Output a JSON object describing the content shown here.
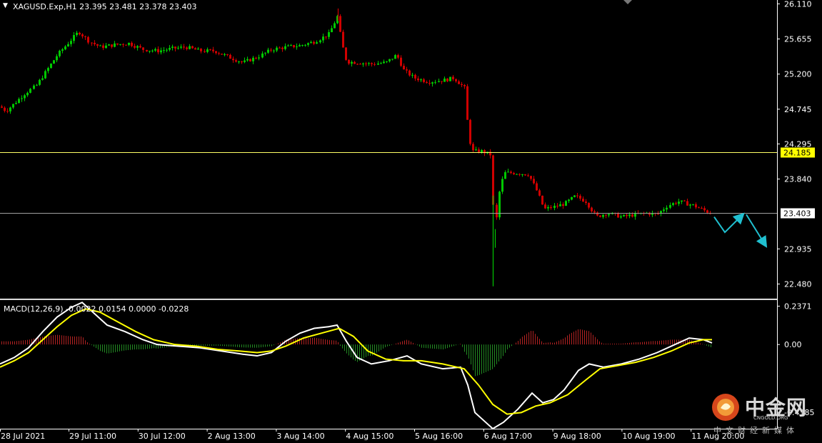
{
  "header": {
    "symbol_line": "XAGUSD.Exp,H1  23.395 23.481 23.378 23.403",
    "macd_line": "MACD(12,26,9) -0.0022 0.0154 0.0000 -0.0228"
  },
  "colors": {
    "background": "#000000",
    "bull": "#00c800",
    "bear": "#d00000",
    "macd_main": "#ffffff",
    "macd_signal": "#ffff00",
    "hist_pos": "#b22222",
    "hist_neg": "#228b22",
    "hline_yellow": "#ffff66",
    "hline_gray": "#a0a0a0",
    "arrow": "#20c0d0",
    "axis": "#ffffff"
  },
  "chart_data": [
    {
      "type": "candlestick",
      "symbol": "XAGUSD.Exp",
      "timeframe": "H1",
      "ohlc_last": {
        "open": 23.395,
        "high": 23.481,
        "low": 23.378,
        "close": 23.403
      },
      "y_ticks": [
        "26.110",
        "25.655",
        "25.200",
        "24.745",
        "24.295",
        "23.840",
        "22.935",
        "22.480"
      ],
      "ylim": [
        22.29,
        26.16
      ],
      "x_ticks": [
        "28 Jul 2021",
        "29 Jul 11:00",
        "30 Jul 12:00",
        "2 Aug 13:00",
        "3 Aug 14:00",
        "4 Aug 15:00",
        "5 Aug 16:00",
        "6 Aug 17:00",
        "9 Aug 18:00",
        "10 Aug 19:00",
        "11 Aug 20:00"
      ],
      "price_path": [
        [
          0,
          24.78
        ],
        [
          8,
          24.72
        ],
        [
          20,
          24.82
        ],
        [
          35,
          24.95
        ],
        [
          50,
          25.05
        ],
        [
          65,
          25.25
        ],
        [
          80,
          25.45
        ],
        [
          95,
          25.6
        ],
        [
          110,
          25.75
        ],
        [
          125,
          25.62
        ],
        [
          140,
          25.55
        ],
        [
          160,
          25.58
        ],
        [
          180,
          25.6
        ],
        [
          200,
          25.52
        ],
        [
          220,
          25.5
        ],
        [
          240,
          25.53
        ],
        [
          260,
          25.55
        ],
        [
          280,
          25.5
        ],
        [
          300,
          25.5
        ],
        [
          320,
          25.42
        ],
        [
          340,
          25.35
        ],
        [
          360,
          25.42
        ],
        [
          380,
          25.52
        ],
        [
          400,
          25.55
        ],
        [
          420,
          25.57
        ],
        [
          440,
          25.62
        ],
        [
          460,
          25.72
        ],
        [
          472,
          25.95
        ],
        [
          478,
          25.6
        ],
        [
          485,
          25.36
        ],
        [
          500,
          25.35
        ],
        [
          520,
          25.33
        ],
        [
          540,
          25.35
        ],
        [
          555,
          25.45
        ],
        [
          565,
          25.25
        ],
        [
          580,
          25.15
        ],
        [
          600,
          25.1
        ],
        [
          620,
          25.12
        ],
        [
          635,
          25.15
        ],
        [
          650,
          25.02
        ],
        [
          655,
          24.5
        ],
        [
          660,
          24.2
        ],
        [
          675,
          24.2
        ],
        [
          688,
          24.15
        ],
        [
          692,
          23.1
        ],
        [
          698,
          23.65
        ],
        [
          705,
          23.92
        ],
        [
          720,
          23.92
        ],
        [
          740,
          23.9
        ],
        [
          752,
          23.68
        ],
        [
          762,
          23.45
        ],
        [
          775,
          23.48
        ],
        [
          790,
          23.52
        ],
        [
          805,
          23.62
        ],
        [
          820,
          23.55
        ],
        [
          835,
          23.35
        ],
        [
          850,
          23.4
        ],
        [
          870,
          23.35
        ],
        [
          890,
          23.38
        ],
        [
          905,
          23.4
        ],
        [
          920,
          23.38
        ],
        [
          935,
          23.5
        ],
        [
          950,
          23.55
        ],
        [
          970,
          23.5
        ],
        [
          994,
          23.4
        ]
      ],
      "big_wicks": [
        {
          "x": 690,
          "low": 22.45
        },
        {
          "x": 473,
          "high": 26.05
        },
        {
          "x": 693,
          "low": 22.95
        }
      ],
      "horizontal_levels": [
        {
          "price": 24.185,
          "label": "24.185",
          "color": "#ffff66"
        },
        {
          "price": 23.403,
          "label": "23.403",
          "color": "#a0a0a0"
        }
      ],
      "forecast_arrows": [
        [
          [
            1000,
            23.35
          ],
          [
            1015,
            23.15
          ],
          [
            1040,
            23.38
          ]
        ],
        [
          [
            1045,
            23.38
          ],
          [
            1072,
            22.98
          ]
        ]
      ]
    },
    {
      "type": "macd",
      "params": "12,26,9",
      "y_ticks": [
        "0.2371",
        "0.00",
        "-0.4185"
      ],
      "ylim": [
        -0.52,
        0.27
      ],
      "main": [
        [
          0,
          -0.12
        ],
        [
          20,
          -0.08
        ],
        [
          40,
          -0.02
        ],
        [
          60,
          0.08
        ],
        [
          80,
          0.17
        ],
        [
          100,
          0.23
        ],
        [
          115,
          0.26
        ],
        [
          130,
          0.2
        ],
        [
          150,
          0.12
        ],
        [
          175,
          0.08
        ],
        [
          200,
          0.03
        ],
        [
          220,
          0.0
        ],
        [
          250,
          -0.01
        ],
        [
          280,
          -0.02
        ],
        [
          310,
          -0.04
        ],
        [
          340,
          -0.06
        ],
        [
          360,
          -0.07
        ],
        [
          380,
          -0.05
        ],
        [
          400,
          0.02
        ],
        [
          420,
          0.07
        ],
        [
          440,
          0.1
        ],
        [
          460,
          0.11
        ],
        [
          472,
          0.12
        ],
        [
          485,
          0.02
        ],
        [
          500,
          -0.08
        ],
        [
          520,
          -0.12
        ],
        [
          545,
          -0.1
        ],
        [
          570,
          -0.07
        ],
        [
          590,
          -0.12
        ],
        [
          620,
          -0.15
        ],
        [
          645,
          -0.14
        ],
        [
          655,
          -0.25
        ],
        [
          665,
          -0.42
        ],
        [
          680,
          -0.48
        ],
        [
          690,
          -0.52
        ],
        [
          705,
          -0.48
        ],
        [
          725,
          -0.4
        ],
        [
          745,
          -0.3
        ],
        [
          760,
          -0.36
        ],
        [
          775,
          -0.34
        ],
        [
          790,
          -0.28
        ],
        [
          810,
          -0.16
        ],
        [
          825,
          -0.12
        ],
        [
          845,
          -0.14
        ],
        [
          870,
          -0.12
        ],
        [
          895,
          -0.09
        ],
        [
          920,
          -0.05
        ],
        [
          945,
          0.0
        ],
        [
          965,
          0.04
        ],
        [
          985,
          0.03
        ],
        [
          997,
          0.01
        ]
      ],
      "signal": [
        [
          0,
          -0.14
        ],
        [
          20,
          -0.1
        ],
        [
          40,
          -0.05
        ],
        [
          60,
          0.03
        ],
        [
          80,
          0.11
        ],
        [
          100,
          0.18
        ],
        [
          120,
          0.22
        ],
        [
          140,
          0.2
        ],
        [
          165,
          0.14
        ],
        [
          190,
          0.08
        ],
        [
          215,
          0.03
        ],
        [
          245,
          0.0
        ],
        [
          275,
          -0.01
        ],
        [
          305,
          -0.03
        ],
        [
          335,
          -0.04
        ],
        [
          360,
          -0.05
        ],
        [
          380,
          -0.04
        ],
        [
          400,
          -0.01
        ],
        [
          425,
          0.04
        ],
        [
          450,
          0.07
        ],
        [
          475,
          0.1
        ],
        [
          495,
          0.05
        ],
        [
          515,
          -0.04
        ],
        [
          540,
          -0.09
        ],
        [
          565,
          -0.1
        ],
        [
          590,
          -0.1
        ],
        [
          620,
          -0.12
        ],
        [
          650,
          -0.15
        ],
        [
          670,
          -0.25
        ],
        [
          690,
          -0.37
        ],
        [
          710,
          -0.43
        ],
        [
          730,
          -0.42
        ],
        [
          750,
          -0.38
        ],
        [
          770,
          -0.36
        ],
        [
          795,
          -0.31
        ],
        [
          820,
          -0.22
        ],
        [
          840,
          -0.15
        ],
        [
          865,
          -0.13
        ],
        [
          890,
          -0.11
        ],
        [
          915,
          -0.08
        ],
        [
          940,
          -0.04
        ],
        [
          965,
          0.01
        ],
        [
          985,
          0.03
        ],
        [
          997,
          0.03
        ]
      ]
    }
  ],
  "watermark": {
    "main": "中金网",
    "sub": "CNGOLD.ORG",
    "tagline": "中文财经新媒体"
  }
}
